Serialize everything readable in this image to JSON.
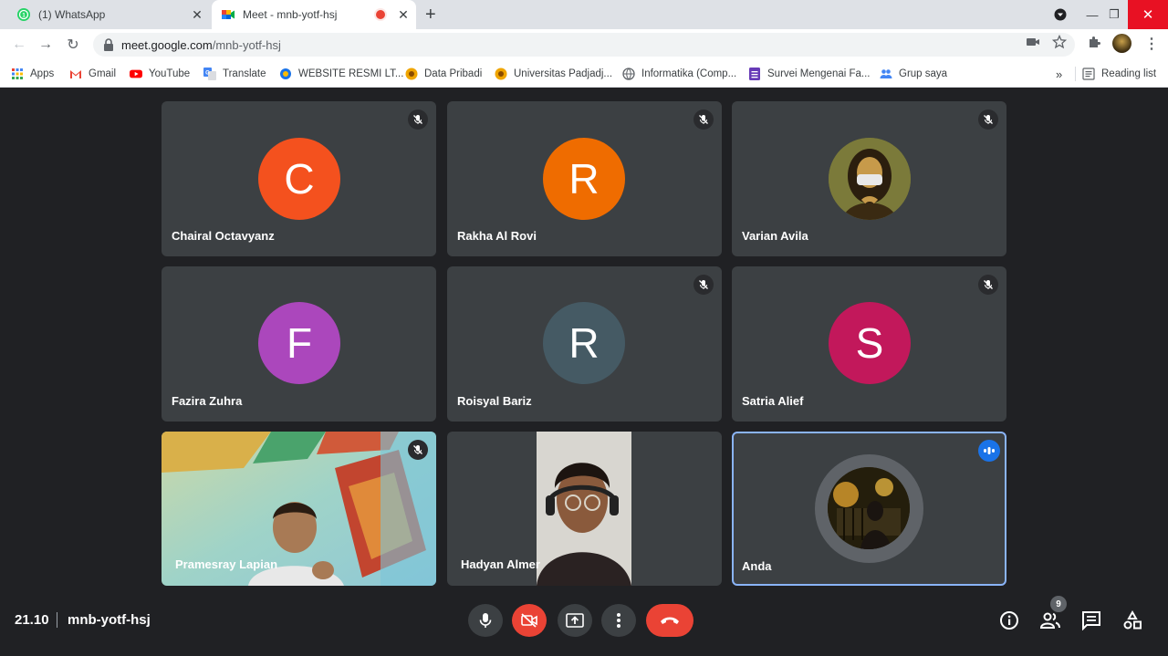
{
  "tabs": [
    {
      "title": "(1) WhatsApp",
      "active": false
    },
    {
      "title": "Meet - mnb-yotf-hsj",
      "active": true
    }
  ],
  "address": {
    "host": "meet.google.com",
    "path": "/mnb-yotf-hsj"
  },
  "bookmarks": [
    "Apps",
    "Gmail",
    "YouTube",
    "Translate",
    "WEBSITE RESMI LT...",
    "Data Pribadi",
    "Universitas Padjadj...",
    "Informatika (Comp...",
    "Survei Mengenai Fa...",
    "Grup saya"
  ],
  "reading_list": "Reading list",
  "participants": [
    {
      "name": "Chairal Octavyanz",
      "initial": "C",
      "color": "#f4511e",
      "muted": true
    },
    {
      "name": "Rakha Al Rovi",
      "initial": "R",
      "color": "#ef6c00",
      "muted": true
    },
    {
      "name": "Varian Avila",
      "initial": "",
      "color": "#8d8f3e",
      "muted": true
    },
    {
      "name": "Fazira Zuhra",
      "initial": "F",
      "color": "#ab47bc",
      "muted": false
    },
    {
      "name": "Roisyal Bariz",
      "initial": "R",
      "color": "#455a64",
      "muted": true
    },
    {
      "name": "Satria Alief",
      "initial": "S",
      "color": "#c2185b",
      "muted": true
    },
    {
      "name": "Pramesray Lapian",
      "initial": "",
      "color": "",
      "muted": true
    },
    {
      "name": "Hadyan Almer",
      "initial": "",
      "color": "",
      "muted": false
    },
    {
      "name": "Anda",
      "initial": "",
      "color": "",
      "muted": false,
      "speaking": true
    }
  ],
  "meeting": {
    "time": "21.10",
    "code": "mnb-yotf-hsj",
    "participant_count": "9"
  }
}
